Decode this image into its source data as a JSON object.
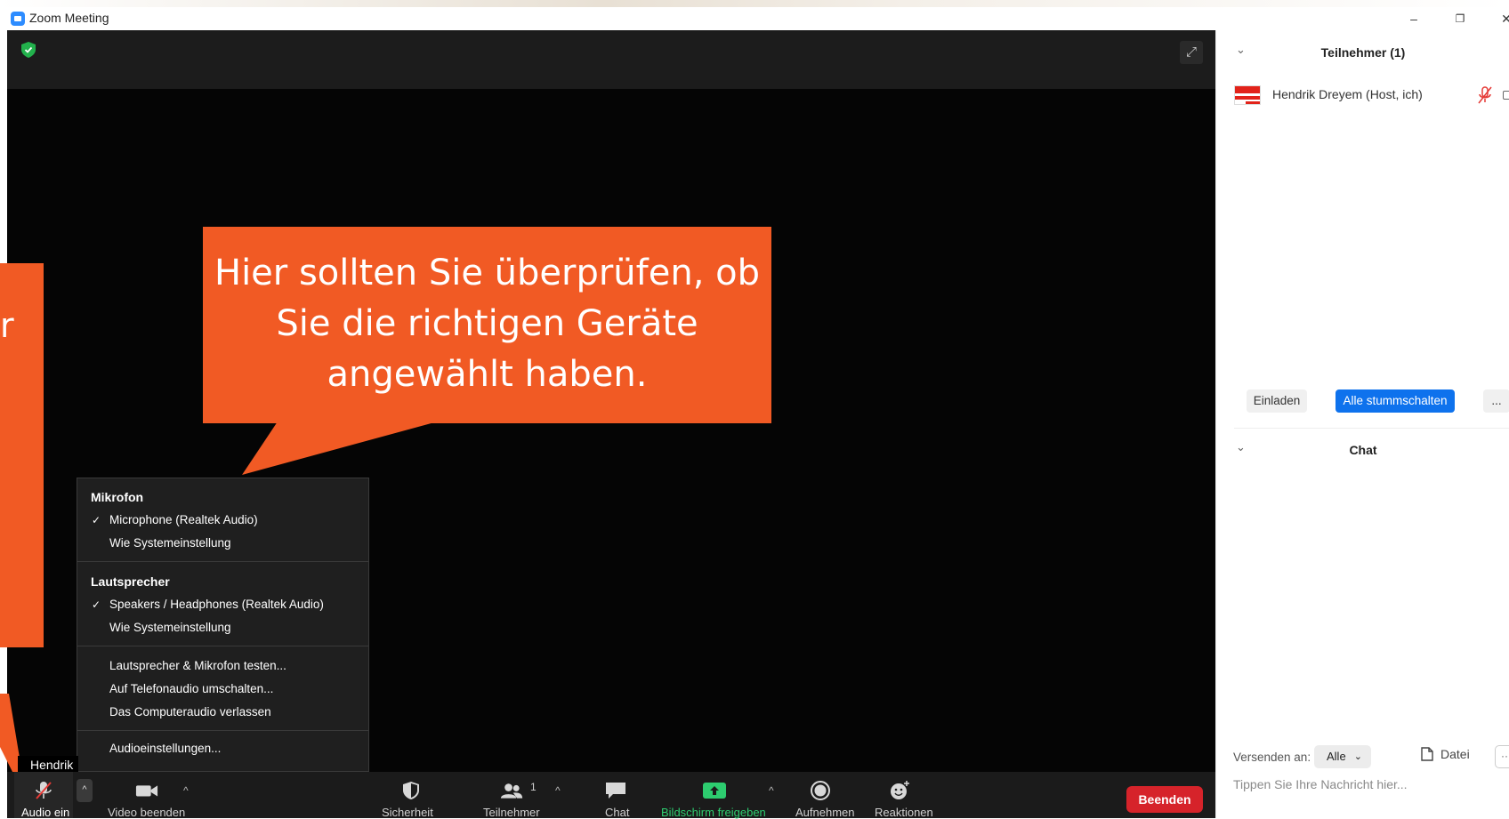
{
  "window": {
    "title": "Zoom Meeting",
    "minimize": "–",
    "restore": "❐",
    "close": "✕"
  },
  "callouts": {
    "left_char": "r",
    "main": "Hier sollten Sie überprüfen, ob Sie die richtigen Geräte angewählt haben."
  },
  "audio_menu": {
    "mic_header": "Mikrofon",
    "mic_items": [
      "Microphone (Realtek Audio)",
      "Wie Systemeinstellung"
    ],
    "speaker_header": "Lautsprecher",
    "speaker_items": [
      "Speakers / Headphones (Realtek Audio)",
      "Wie Systemeinstellung"
    ],
    "actions": [
      "Lautsprecher & Mikrofon testen...",
      "Auf Telefonaudio umschalten...",
      "Das Computeraudio verlassen"
    ],
    "settings": "Audioeinstellungen...",
    "check": "✓"
  },
  "name_tag": "Hendrik",
  "toolbar": {
    "audio": "Audio ein",
    "video": "Video beenden",
    "security": "Sicherheit",
    "participants": "Teilnehmer",
    "participants_count": "1",
    "chat": "Chat",
    "share": "Bildschirm freigeben",
    "record": "Aufnehmen",
    "reactions": "Reaktionen",
    "end": "Beenden",
    "caret": "^",
    "share_color": "#2dcc6f"
  },
  "panel": {
    "participants_header": "Teilnehmer (1)",
    "participant_name": "Hendrik Dreyem (Host, ich)",
    "invite": "Einladen",
    "mute_all": "Alle stummschalten",
    "more": "...",
    "chat_header": "Chat",
    "send_to_label": "Versenden an:",
    "send_to_value": "Alle",
    "file": "Datei",
    "file_more": "···",
    "chat_placeholder": "Tippen Sie Ihre Nachricht hier...",
    "accent": "#0e72ed"
  }
}
